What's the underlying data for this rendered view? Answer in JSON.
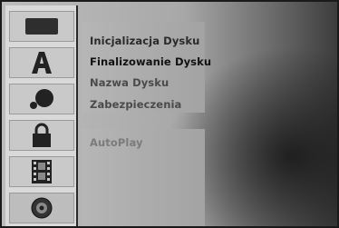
{
  "sidebar": {
    "items": [
      {
        "icon": "disc-rectangle-icon"
      },
      {
        "icon": "letter-a-icon"
      },
      {
        "icon": "sound-icon"
      },
      {
        "icon": "lock-icon"
      },
      {
        "icon": "film-strip-icon"
      },
      {
        "icon": "dvd-disc-icon",
        "active": true
      }
    ]
  },
  "menu": {
    "items": [
      {
        "label": "Inicjalizacja Dysku"
      },
      {
        "label": "Finalizowanie Dysku"
      },
      {
        "label": "Nazwa Dysku"
      },
      {
        "label": "Zabezpieczenia"
      },
      {
        "label": "AutoPlay"
      }
    ]
  }
}
